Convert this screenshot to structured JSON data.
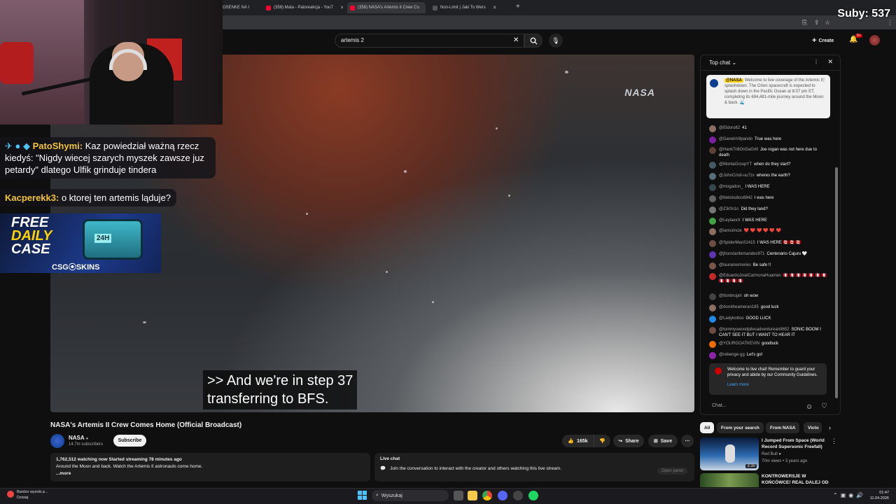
{
  "browser": {
    "tabs": [
      {
        "label": "OSENKE NA I",
        "active": false
      },
      {
        "label": "(358) Mata - Patoreakcja - YouT",
        "active": false
      },
      {
        "label": "(358) NASA's Artemis II Crew Co",
        "active": true
      },
      {
        "label": "Non-Limit | Jaki To Wers",
        "active": false
      }
    ]
  },
  "youtube": {
    "search_value": "artemis 2",
    "create_label": "Create",
    "notif_count": "9+"
  },
  "stream_overlay": {
    "subs_label": "Suby: 537",
    "chat": [
      {
        "user": "PatoShymi:",
        "text": " Kaz powiedział ważną rzecz kiedyś: \"Nigdy wiecej szarych myszek zawsze juz petardy\" dlatego Ulfik grinduje tindera"
      },
      {
        "user": "Kacperekk3:",
        "text": " o ktorej ten artemis ląduje?"
      }
    ],
    "promo": {
      "line1": "FREE",
      "line2": "DAILY",
      "line3": "CASE",
      "badge": "24H",
      "brand": "CSG⦿SKINS"
    }
  },
  "video": {
    "caption": ">> And we're in step 37\ntransferring to BFS.",
    "watermark": "NASA",
    "title": "NASA's Artemis II Crew Comes Home (Official Broadcast)",
    "channel": "NASA",
    "channel_subs": "14.7m subscribers",
    "subscribe_label": "Subscribe",
    "likes": "165k",
    "share_label": "Share",
    "save_label": "Save",
    "description": {
      "stats": "1,762,512 watching now  Started streaming 78 minutes ago",
      "text": "Around the Moon and back. Watch the Artemis II astronauts come home.",
      "more": "...more"
    },
    "live_chat_box": {
      "title": "Live chat",
      "text": "Join the conversation to interact with the creator and others watching this live stream.",
      "open_panel": "Open panel"
    }
  },
  "live_chat": {
    "header": "Top chat",
    "pinned": {
      "author": "@NASA",
      "text": "Welcome to live coverage of the Artemis II splashdown. The Orion spacecraft is expected to splash down in the Pacific Ocean at 8:07 pm ET, completing its 694,481-mile journey around the Moon & back. 🌊"
    },
    "messages": [
      {
        "author": "@Eldoro82",
        "text": "41",
        "color": "#8d6e63"
      },
      {
        "author": "@DarwinVilpando",
        "text": "True was here",
        "color": "#7b1fa2"
      },
      {
        "author": "@HankTrillOnDaGrill",
        "text": "Joe rogan was not here due to death",
        "color": "#5d4037"
      },
      {
        "author": "@MontaGroupYT",
        "text": "when do they start?",
        "color": "#455a64"
      },
      {
        "author": "@JohnCristi-uu7zs",
        "text": "wheres the earth?",
        "color": "#546e7a"
      },
      {
        "author": "@mogadon_",
        "text": "I WAS HERE",
        "color": "#37474f"
      },
      {
        "author": "@bielstudios6942",
        "text": "I was here",
        "color": "#616161"
      },
      {
        "author": "@Z3r0n1n",
        "text": "Did they land?",
        "color": "#757575"
      },
      {
        "author": "@LeylaexX",
        "text": "I WAS HERE",
        "color": "#43a047"
      },
      {
        "author": "@iamcimcie",
        "text": "❤️ ❤️ ❤️ ❤️ ❤️ ❤️",
        "color": "#8d6e63"
      },
      {
        "author": "@SpiderMan31415",
        "text": "I WAS HERE 🇨🇦 🇨🇦 🇨🇦",
        "color": "#6d4c41"
      },
      {
        "author": "@jhonstanfernandes971",
        "text": "Centenário Cajuru 🤍",
        "color": "#5e35b1"
      },
      {
        "author": "@lauramemories",
        "text": "Be safe !!",
        "color": "#795548"
      },
      {
        "author": "@EduardoJoséCarmonaHuamán",
        "text": "🇵🇪 🇵🇪 🇵🇪 🇵🇪 🇵🇪 🇵🇪 🇵🇪 🇵🇪 🇵🇪 🇵🇪 🇵🇪",
        "color": "#c62828"
      },
      {
        "author": "@ttonbrujah",
        "text": "oh wow",
        "color": "#424242"
      },
      {
        "author": "@dorotheameran185",
        "text": "good luck",
        "color": "#8d6e63"
      },
      {
        "author": "@Ladykottoo",
        "text": "GOOD LUCK",
        "color": "#1e88e5"
      },
      {
        "author": "@tommyswoodpilesadventurean9652",
        "text": "SONIC BOOM I CAN'T SEE IT BUT I WANT TO HEAR IT",
        "color": "#6d4c41"
      },
      {
        "author": "@YOURGOATKEVIN",
        "text": "goodluck",
        "color": "#ef6c00"
      },
      {
        "author": "@rebenge-gg",
        "text": "Let's go!",
        "color": "#8e24aa"
      }
    ],
    "notice": "Welcome to live chat! Remember to guard your privacy and abide by our Community Guidelines.",
    "notice_more": "Learn more",
    "input_placeholder": "Chat..."
  },
  "recommendations": {
    "chips": [
      "All",
      "From your search",
      "From NASA",
      "Victo"
    ],
    "videos": [
      {
        "title": "I Jumped From Space (World Record Supersonic Freefall)",
        "channel": "Red Bull",
        "meta": "70m views • 3 years ago",
        "duration": "3:30"
      },
      {
        "title": "KONTROWERSJE W KOŃCÓWCE! REAL DALEJ OD ...",
        "channel": "",
        "meta": "",
        "duration": ""
      }
    ]
  },
  "taskbar": {
    "weather_line1": "Bardzo wysoki p...",
    "weather_line2": "Dzisiaj",
    "search_label": "Wyszukaj",
    "time": "01:47",
    "date": "11.04.2026"
  }
}
